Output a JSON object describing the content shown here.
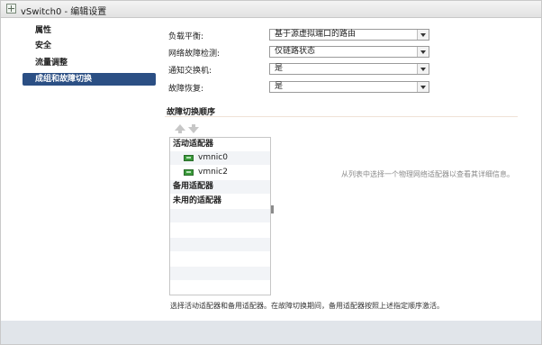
{
  "window": {
    "title": "vSwitch0 - 编辑设置"
  },
  "nav": {
    "items": [
      {
        "label": "属性",
        "selected": false
      },
      {
        "label": "安全",
        "selected": false
      },
      {
        "label": "流量调整",
        "selected": false
      },
      {
        "label": "成组和故障切换",
        "selected": true
      }
    ]
  },
  "form": {
    "fields": [
      {
        "label": "负载平衡:",
        "value": "基于源虚拟端口的路由"
      },
      {
        "label": "网络故障检测:",
        "value": "仅链路状态"
      },
      {
        "label": "通知交换机:",
        "value": "是"
      },
      {
        "label": "故障恢复:",
        "value": "是"
      }
    ]
  },
  "failover": {
    "section_title": "故障切换顺序",
    "groups": {
      "active": "活动适配器",
      "standby": "备用适配器",
      "unused": "未用的适配器"
    },
    "active_adapters": [
      "vmnic0",
      "vmnic2"
    ],
    "detail_hint": "从列表中选择一个物理网络适配器以查看其详细信息。",
    "footnote": "选择活动适配器和备用适配器。在故障切换期间，备用适配器按照上述指定顺序激活。"
  },
  "icons": {
    "window": "vswitch-icon",
    "move_up": "arrow-up-icon",
    "move_down": "arrow-down-icon",
    "adapter": "network-adapter-icon"
  },
  "colors": {
    "nav_selected": "#2b4f84",
    "bottom_bar": "#e1e5ea",
    "adapter_icon": "#3b9a3b"
  }
}
